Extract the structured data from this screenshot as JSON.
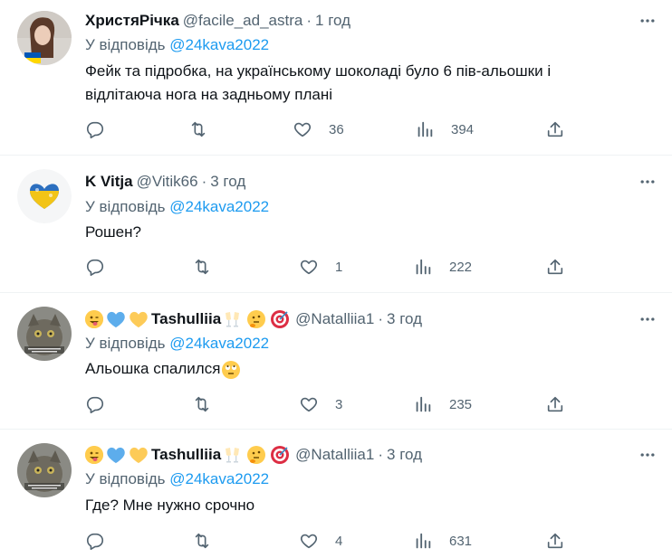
{
  "tweets": [
    {
      "display_name": "ХристяРічка",
      "handle": "@facile_ad_astra",
      "time": "1 год",
      "reply_prefix": "У відповідь",
      "reply_handle": "@24kava2022",
      "text_line1": "Фейк та підробка, на українському шоколаді було 6 пів-альошки і",
      "text_line2": "відлітаюча нога на задньому плані",
      "replies": "",
      "retweets": "",
      "likes": "36",
      "views": "394"
    },
    {
      "display_name": "K Vitja",
      "handle": "@Vitik66",
      "time": "3 год",
      "reply_prefix": "У відповідь",
      "reply_handle": "@24kava2022",
      "text_line1": "Рошен?",
      "replies": "",
      "retweets": "",
      "likes": "1",
      "views": "222"
    },
    {
      "display_name": "Tashulliia",
      "handle": "@Natalliia1",
      "time": "3 год",
      "reply_prefix": "У відповідь",
      "reply_handle": "@24kava2022",
      "text_line1": "Альошка спалился",
      "replies": "",
      "retweets": "",
      "likes": "3",
      "views": "235"
    },
    {
      "display_name": "Tashulliia",
      "handle": "@Natalliia1",
      "time": "3 год",
      "reply_prefix": "У відповідь",
      "reply_handle": "@24kava2022",
      "text_line1": "Где? Мне нужно срочно",
      "replies": "",
      "retweets": "",
      "likes": "4",
      "views": "631"
    }
  ],
  "icons": {
    "more": "more-horizontal-icon",
    "reply": "reply-icon",
    "retweet": "retweet-icon",
    "like": "heart-icon",
    "views": "views-chart-icon",
    "share": "share-icon"
  },
  "colors": {
    "link": "#1d9bf0",
    "secondary_text": "#536471",
    "primary_text": "#0f1419",
    "divider": "#eff3f4"
  }
}
